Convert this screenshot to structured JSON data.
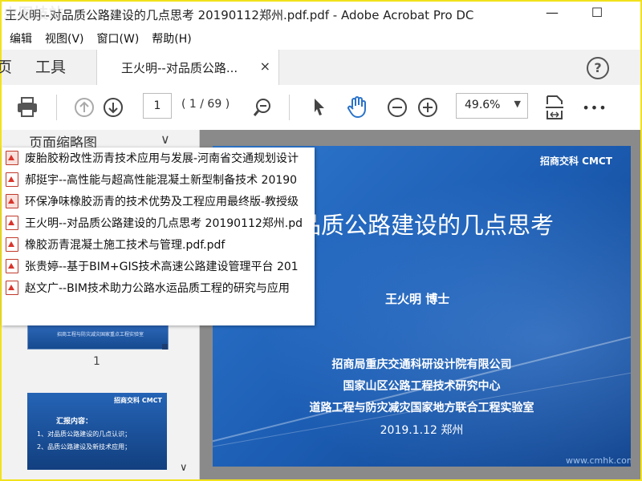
{
  "window": {
    "title": "王火明--对品质公路建设的几点思考 20190112郑州.pdf.pdf - Adobe Acrobat Pro DC",
    "watermark": "火图技站",
    "minimize": "—",
    "maximize": "☐"
  },
  "menu": [
    "编辑",
    "视图(V)",
    "窗口(W)",
    "帮助(H)"
  ],
  "tabs": {
    "home_partial": "页",
    "tools": "工具",
    "document": "王火明--对品质公路...",
    "close": "×",
    "help": "?"
  },
  "toolbar": {
    "page_number": "1",
    "page_count": "( 1 / 69 )",
    "zoom": "49.6%",
    "more": "•••"
  },
  "sidebar": {
    "title": "页面缩略图",
    "thumb1_text": "招商工程与防灾减灾国家重点工程实验室",
    "thumb1_number": "1",
    "thumb2_logo": "招商交科 CMCT",
    "thumb2_line1": "汇报内容：",
    "thumb2_line2": "1、对品质公路建设的几点认识；",
    "thumb2_line3": "2、品质公路建设及新技术应用；"
  },
  "recent_files": [
    {
      "name": "废胎胶粉改性沥青技术应用与发展-河南省交通规划设计",
      "type": "ppt"
    },
    {
      "name": "郝挺宇--高性能与超高性能混凝土新型制备技术 20190",
      "type": "pdf"
    },
    {
      "name": "环保净味橡胶沥青的技术优势及工程应用最终版-教授级",
      "type": "ppt"
    },
    {
      "name": "王火明--对品质公路建设的几点思考 20190112郑州.pd",
      "type": "pdf"
    },
    {
      "name": "橡胶沥青混凝土施工技术与管理.pdf.pdf",
      "type": "pdf"
    },
    {
      "name": "张贵婷--基于BIM+GIS技术高速公路建设管理平台  201",
      "type": "pdf"
    },
    {
      "name": "赵文广--BIM技术助力公路水运品质工程的研究与应用",
      "type": "pdf"
    }
  ],
  "slide": {
    "logo": "招商交科 CMCT",
    "title": "品质公路建设的几点思考",
    "author": "王火明 博士",
    "org1": "招商局重庆交通科研设计院有限公司",
    "org2": "国家山区公路工程技术研究中心",
    "org3": "道路工程与防灾减灾国家地方联合工程实验室",
    "date": "2019.1.12   郑州",
    "footer": "www.cmhk.com"
  }
}
